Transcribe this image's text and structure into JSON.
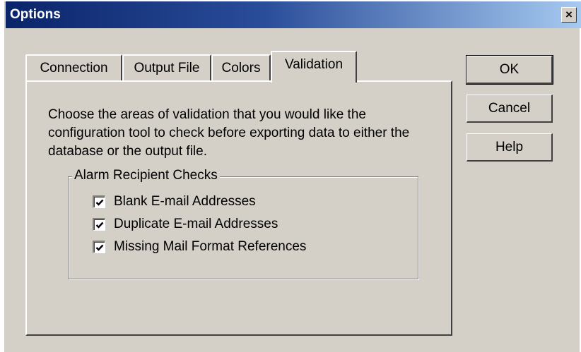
{
  "dialog": {
    "title": "Options",
    "close_label": "×"
  },
  "tabs": [
    {
      "label": "Connection",
      "active": false
    },
    {
      "label": "Output File",
      "active": false
    },
    {
      "label": "Colors",
      "active": false
    },
    {
      "label": "Validation",
      "active": true
    }
  ],
  "validation": {
    "description": "Choose the areas of validation that you would like the configuration tool to check before exporting data to either the database or the output file.",
    "group_label": "Alarm Recipient Checks",
    "checks": [
      {
        "label": "Blank E-mail Addresses",
        "checked": true
      },
      {
        "label": "Duplicate E-mail Addresses",
        "checked": true
      },
      {
        "label": "Missing Mail Format References",
        "checked": true
      }
    ]
  },
  "buttons": {
    "ok": "OK",
    "cancel": "Cancel",
    "help": "Help"
  },
  "colors": {
    "titlebar_start": "#0a246a",
    "titlebar_end": "#a6caf0",
    "face": "#d4d0c8"
  }
}
